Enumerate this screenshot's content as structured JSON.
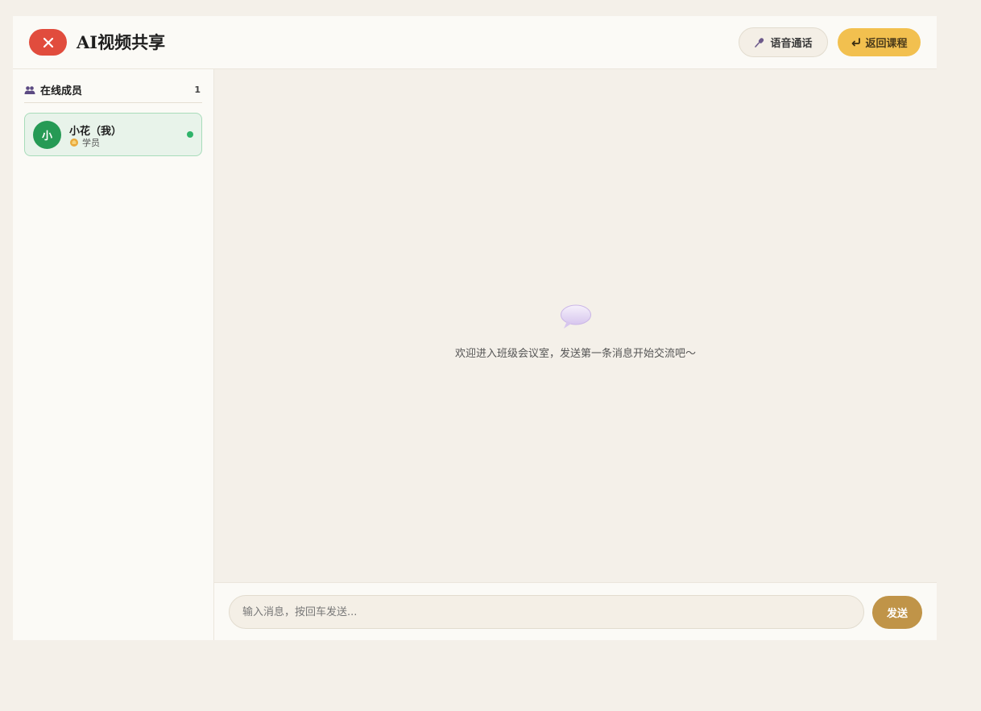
{
  "header": {
    "title": "AI视频共享",
    "voice_call_label": "语音通话",
    "back_label": "返回课程"
  },
  "icons": {
    "close": "close-icon",
    "voice": "microphone-icon",
    "back": "return-arrow-icon",
    "members": "people-icon",
    "role": "badge-icon",
    "empty": "speech-bubble-icon"
  },
  "colors": {
    "close_button": "#e14c3d",
    "back_button": "#f2c04f",
    "send_button": "#c09448",
    "avatar": "#269a55",
    "online": "#2fb36a"
  },
  "sidebar": {
    "heading": "在线成员",
    "count": "1",
    "members": [
      {
        "avatar_text": "小",
        "name": "小花（我）",
        "role": "学员",
        "online": true
      }
    ]
  },
  "chat": {
    "empty_message": "欢迎进入班级会议室，发送第一条消息开始交流吧～"
  },
  "composer": {
    "placeholder": "输入消息，按回车发送...",
    "value": "",
    "send_label": "发送"
  }
}
